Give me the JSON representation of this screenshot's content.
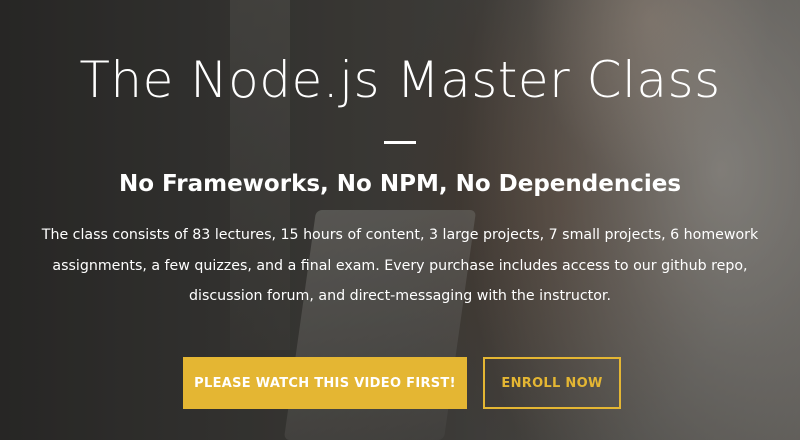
{
  "hero": {
    "headline": "The Node.js Master Class",
    "subheadline": "No Frameworks, No NPM, No Dependencies",
    "description": "The class consists of 83 lectures, 15 hours of content, 3 large projects, 7 small projects, 6 homework assignments, a few quizzes, and a final exam. Every purchase includes access to our github repo, discussion forum, and direct-messaging with the instructor."
  },
  "buttons": {
    "watch_video_label": "PLEASE WATCH THIS VIDEO FIRST!",
    "enroll_label": "ENROLL NOW"
  },
  "colors": {
    "accent": "#e4b633",
    "text": "#ffffff"
  }
}
